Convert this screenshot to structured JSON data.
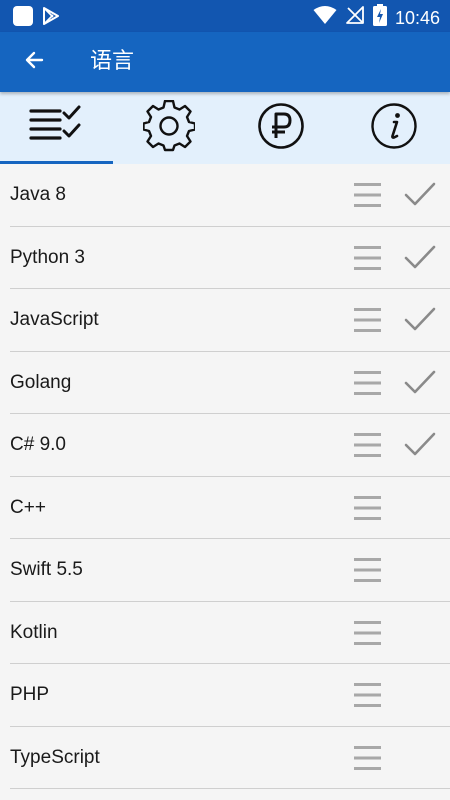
{
  "status_bar": {
    "time": "10:46",
    "icons": [
      "app-square-icon",
      "play-store-icon",
      "wifi-icon",
      "no-signal-icon",
      "battery-charging-icon"
    ]
  },
  "app_bar": {
    "back_icon": "arrow-left-icon",
    "title": "语言"
  },
  "tabs": [
    {
      "icon": "checklist-icon",
      "active": true
    },
    {
      "icon": "gear-icon",
      "active": false
    },
    {
      "icon": "ruble-icon",
      "active": false
    },
    {
      "icon": "info-icon",
      "active": false
    }
  ],
  "languages": [
    {
      "label": "Java 8",
      "checked": true
    },
    {
      "label": "Python 3",
      "checked": true
    },
    {
      "label": "JavaScript",
      "checked": true
    },
    {
      "label": "Golang",
      "checked": true
    },
    {
      "label": "C# 9.0",
      "checked": true
    },
    {
      "label": "C++",
      "checked": false
    },
    {
      "label": "Swift 5.5",
      "checked": false
    },
    {
      "label": "Kotlin",
      "checked": false
    },
    {
      "label": "PHP",
      "checked": false
    },
    {
      "label": "TypeScript",
      "checked": false
    }
  ],
  "colors": {
    "status_bar": "#1256b0",
    "app_bar": "#1565c0",
    "tab_bar": "#e3f0fc",
    "accent": "#1565c0",
    "drag_handle": "#a8a8a8",
    "check": "#8a8a8a"
  }
}
